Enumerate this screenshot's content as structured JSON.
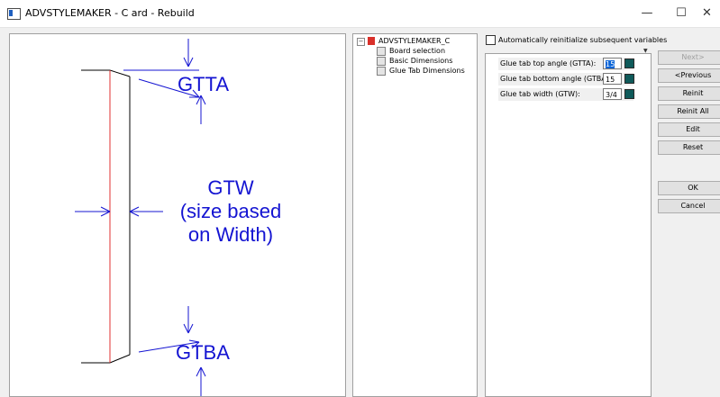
{
  "window": {
    "title": "ADVSTYLEMAKER - C ard - Rebuild",
    "minimize": "—",
    "maximize": "☐",
    "close": "✕"
  },
  "drawing": {
    "label_top": "GTTA",
    "label_width": [
      "GTW",
      "(size based",
      "on Width)"
    ],
    "label_bottom": "GTBA",
    "line_color": "#1414d2",
    "edge_color": "#e03030"
  },
  "tree": {
    "root": "ADVSTYLEMAKER_C",
    "items": [
      "Board selection",
      "Basic Dimensions",
      "Glue Tab Dimensions"
    ]
  },
  "auto_reinit": {
    "label": "Automatically reinitialize subsequent variables",
    "checked": false
  },
  "params": [
    {
      "label": "Glue tab top angle (GTTA):",
      "value": "15"
    },
    {
      "label": "Glue tab bottom angle (GTBA):",
      "value": "15"
    },
    {
      "label": "Glue tab width (GTW):",
      "value": "3/4"
    }
  ],
  "buttons": {
    "next": "Next>",
    "previous": "<Previous",
    "reinit": "Reinit",
    "reinit_all": "Reinit All",
    "edit": "Edit",
    "reset": "Reset",
    "ok": "OK",
    "cancel": "Cancel"
  }
}
